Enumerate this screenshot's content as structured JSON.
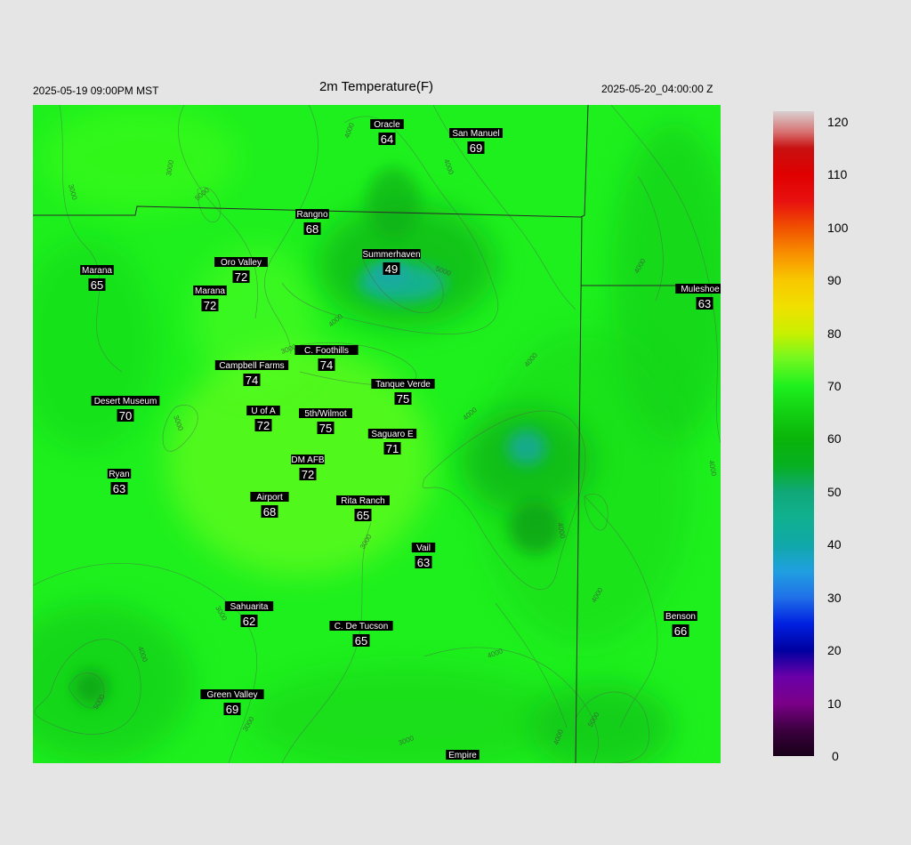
{
  "header": {
    "local_time": "2025-05-19 09:00PM MST",
    "title": "2m Temperature(F)",
    "utc_time": "2025-05-20_04:00:00 Z"
  },
  "colorbar": {
    "ticks": [
      "0",
      "10",
      "20",
      "30",
      "40",
      "50",
      "60",
      "70",
      "80",
      "90",
      "100",
      "110",
      "120"
    ],
    "min": 0,
    "max": 122
  },
  "contour_labels": [
    "3000",
    "4000",
    "5000",
    "6000",
    "7000",
    "8000"
  ],
  "stations": [
    {
      "name": "Oracle",
      "temp": "64"
    },
    {
      "name": "San Manuel",
      "temp": "69"
    },
    {
      "name": "Rangno",
      "temp": "68"
    },
    {
      "name": "Summerhaven",
      "temp": "49"
    },
    {
      "name": "Marana",
      "temp": "65"
    },
    {
      "name": "Oro Valley",
      "temp": "72"
    },
    {
      "name": "Marana",
      "temp": "72"
    },
    {
      "name": "Mule­shoe R",
      "temp": "63"
    },
    {
      "name": "C. Foothills",
      "temp": "74"
    },
    {
      "name": "Campbell Farms",
      "temp": "74"
    },
    {
      "name": "Tanque Verde",
      "temp": "75"
    },
    {
      "name": "Desert Museum",
      "temp": "70"
    },
    {
      "name": "U of A",
      "temp": "72"
    },
    {
      "name": "5th/Wilmot",
      "temp": "75"
    },
    {
      "name": "Saguaro E",
      "temp": "71"
    },
    {
      "name": "DM AFB",
      "temp": "72"
    },
    {
      "name": "Ryan",
      "temp": "63"
    },
    {
      "name": "Airport",
      "temp": "68"
    },
    {
      "name": "Rita Ranch",
      "temp": "65"
    },
    {
      "name": "Vail",
      "temp": "63"
    },
    {
      "name": "Sahuarita",
      "temp": "62"
    },
    {
      "name": "C. De Tucson",
      "temp": "65"
    },
    {
      "name": "Benson",
      "temp": "66"
    },
    {
      "name": "Green Valley",
      "temp": "69"
    },
    {
      "name": "Empire",
      "temp": ""
    }
  ],
  "colors": {
    "background": "#e5e5e5",
    "map_base": "#1ef01e",
    "label_bg": "#000000",
    "label_fg": "#ffffff"
  }
}
